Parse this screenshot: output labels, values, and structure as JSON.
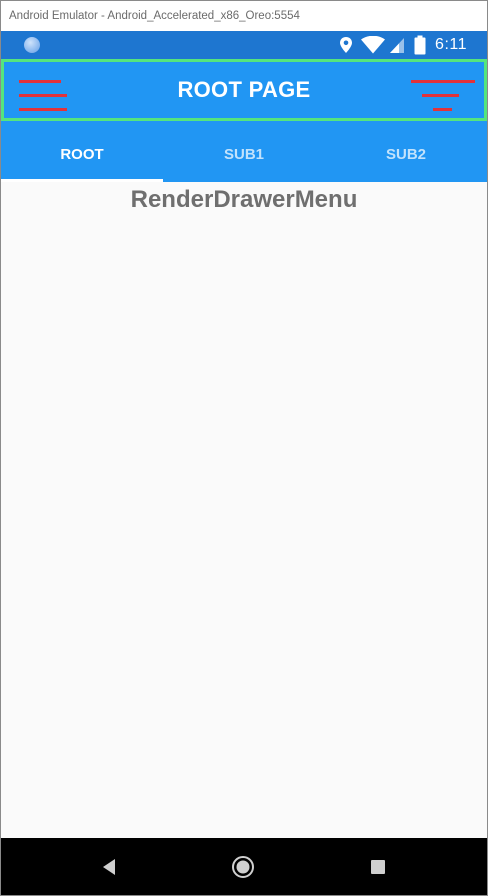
{
  "window": {
    "title": "Android Emulator - Android_Accelerated_x86_Oreo:5554"
  },
  "status_bar": {
    "time": "6:11",
    "icons": [
      "notification-dot-icon",
      "location-pin-icon",
      "wifi-icon",
      "signal-icon",
      "battery-icon"
    ],
    "background": "#1e76d0"
  },
  "toolbar": {
    "title": "ROOT PAGE",
    "left_icon": "hamburger-menu-icon",
    "right_icon": "filter-menu-icon",
    "background": "#2196f3",
    "border_color": "#55e57e",
    "icon_color": "#e2323a"
  },
  "tabs": [
    {
      "label": "ROOT",
      "selected": true
    },
    {
      "label": "SUB1",
      "selected": false
    },
    {
      "label": "SUB2",
      "selected": false
    }
  ],
  "content": {
    "heading": "RenderDrawerMenu"
  },
  "nav_bar": {
    "buttons": [
      "back-icon",
      "home-icon",
      "recents-icon"
    ]
  }
}
